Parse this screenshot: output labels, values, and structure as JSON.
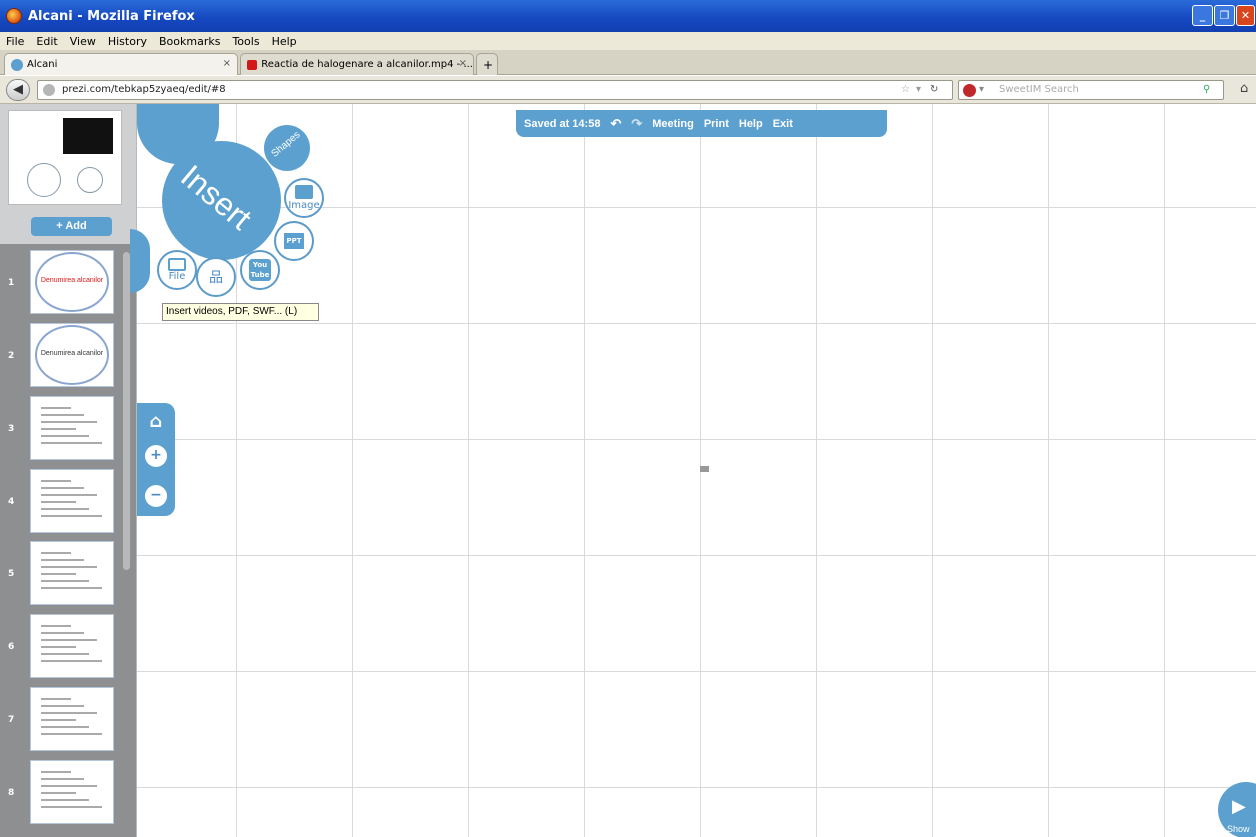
{
  "window": {
    "title": "Alcani - Mozilla Firefox"
  },
  "menu": [
    "File",
    "Edit",
    "View",
    "History",
    "Bookmarks",
    "Tools",
    "Help"
  ],
  "tabs": [
    {
      "label": "Alcani",
      "close": "×"
    },
    {
      "label": "Reactia de halogenare a alcanilor.mp4 - ...",
      "close": "×"
    }
  ],
  "newtab": "+",
  "nav": {
    "url": "prezi.com/tebkap5zyaeq/edit/#8",
    "search_placeholder": "SweetIM Search"
  },
  "prezi": {
    "toolbar": {
      "saved": "Saved at 14:58",
      "meeting": "Meeting",
      "print": "Print",
      "help": "Help",
      "exit": "Exit"
    },
    "insert_menu": {
      "insert": "Insert",
      "shapes": "Shapes",
      "image": "Image",
      "ppt": "PPT",
      "youtube": "You Tube",
      "file": "File",
      "tooltip": "Insert videos, PDF, SWF... (L)"
    },
    "add_button": "+ Add",
    "slides": [
      {
        "num": "1",
        "title": "Denumirea alcanilor"
      },
      {
        "num": "2",
        "title": "Denumirea alcanilor"
      },
      {
        "num": "3"
      },
      {
        "num": "4"
      },
      {
        "num": "5"
      },
      {
        "num": "6"
      },
      {
        "num": "7"
      },
      {
        "num": "8"
      }
    ],
    "show_label": "Show"
  },
  "colors": {
    "accent": "#5ba0cf",
    "titlebar": "#1547c0"
  }
}
